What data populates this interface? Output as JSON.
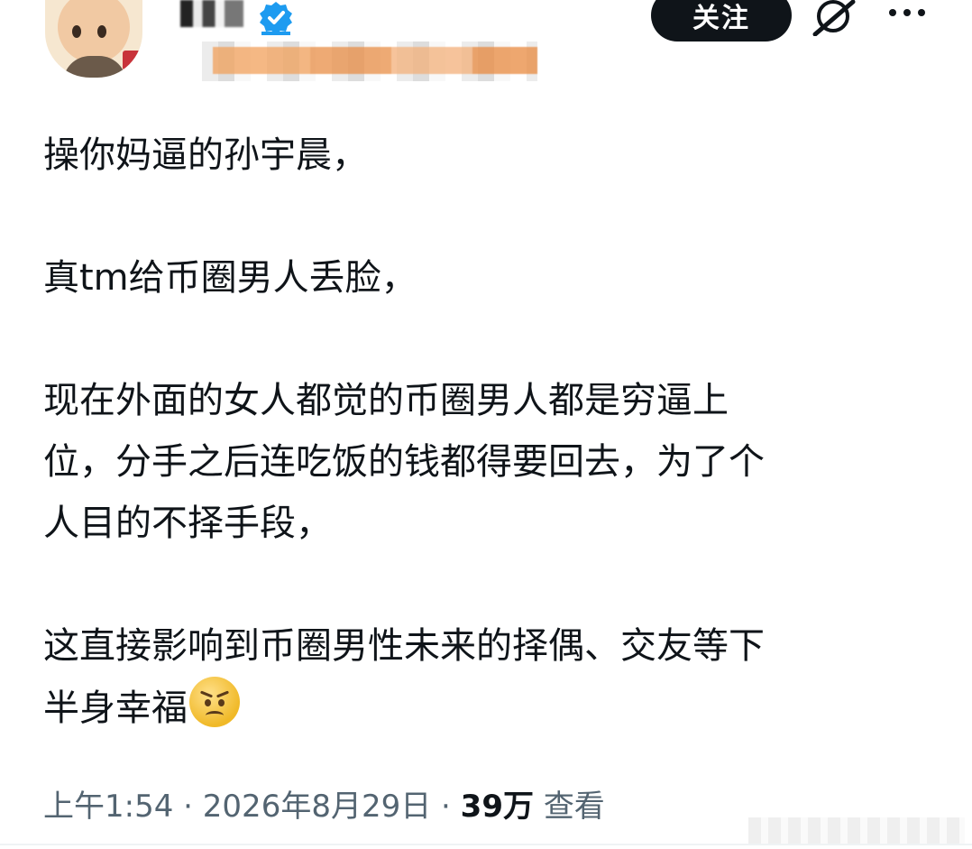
{
  "header": {
    "follow_label": "关注",
    "icons": [
      "grok-icon",
      "more-icon",
      "verified-icon"
    ]
  },
  "tweet": {
    "paragraphs": [
      "操你妈逼的孙宇晨，",
      "真tm给币圈男人丢脸，",
      "现在外面的女人都觉的币圈男人都是穷逼上\n位，分手之后连吃饭的钱都得要回去，为了个\n人目的不择手段，",
      "这直接影响到币圈男性未来的择偶、交友等下\n半身幸福"
    ],
    "emoji": "angry-face-emoji"
  },
  "meta": {
    "time": "上午1:54",
    "date": "2026年8月29日",
    "views_count": "39万",
    "views_label": "查看"
  },
  "colors": {
    "text": "#0f1419",
    "secondary": "#536471",
    "button_bg": "#0f1419",
    "verified": "#1d9bf0"
  }
}
